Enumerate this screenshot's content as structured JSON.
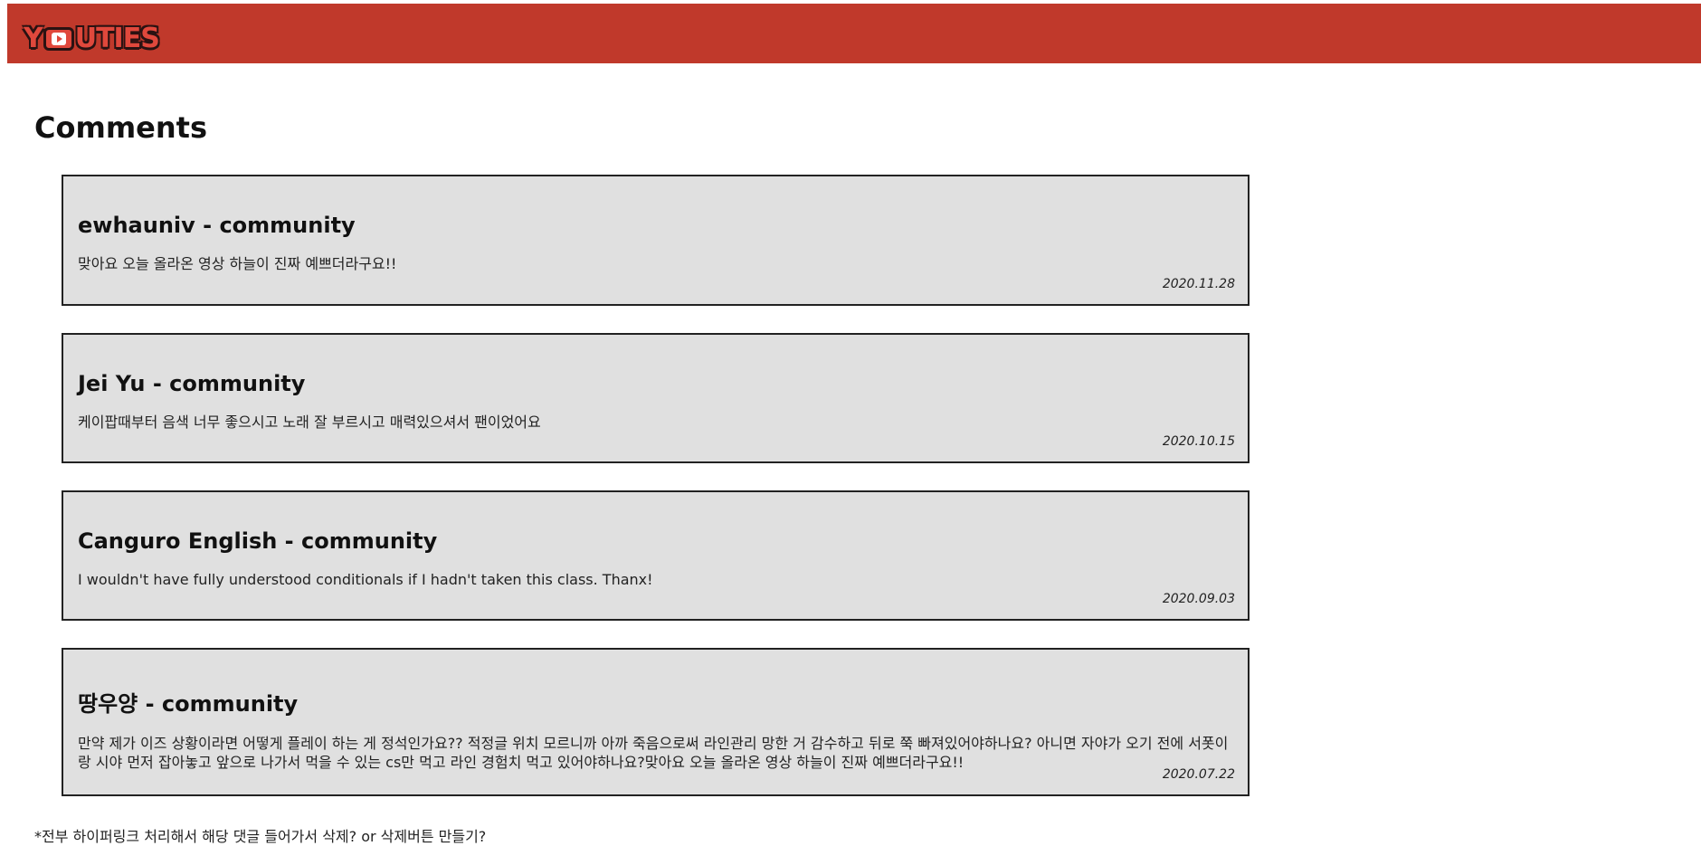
{
  "header": {
    "logo_text_left": "Y",
    "logo_text_right": "UTIES",
    "accent_color": "#c0392b"
  },
  "page": {
    "title": "Comments"
  },
  "comments": [
    {
      "author": "ewhauniv - community",
      "text": "맞아요 오늘 올라온 영상 하늘이 진짜 예쁘더라구요!!",
      "date": "2020.11.28"
    },
    {
      "author": "Jei Yu - community",
      "text": "케이팝때부터 음색 너무 좋으시고 노래 잘 부르시고 매력있으셔서 팬이었어요",
      "date": "2020.10.15"
    },
    {
      "author": "Canguro English - community",
      "text": "I wouldn't have fully understood conditionals if I hadn't taken this class. Thanx!",
      "date": "2020.09.03"
    },
    {
      "author": "땅우양 - community",
      "text": "만약 제가 이즈 상황이라면 어떻게 플레이 하는 게 정석인가요?? 적정글 위치 모르니까 아까 죽음으로써 라인관리 망한 거 감수하고 뒤로 쭉 빠져있어야하나요? 아니면 자야가 오기 전에 서폿이랑 시야 먼저 잡아놓고 앞으로 나가서 먹을 수 있는 cs만 먹고 라인 경험치 먹고 있어야하나요?맞아요 오늘 올라온 영상 하늘이 진짜 예쁘더라구요!!",
      "date": "2020.07.22"
    }
  ],
  "footnote": "*전부 하이퍼링크 처리해서 해당 댓글 들어가서 삭제? or 삭제버튼 만들기?"
}
